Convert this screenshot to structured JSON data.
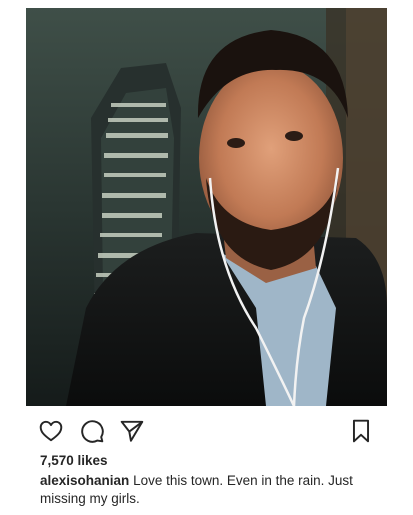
{
  "post": {
    "likes_text": "7,570 likes",
    "caption_username": "alexisohanian",
    "caption_text": "Love this town. Even in the rain. Just missing my girls."
  },
  "icons": {
    "like": "heart-icon",
    "comment": "comment-icon",
    "share": "send-icon",
    "save": "bookmark-icon"
  },
  "colors": {
    "text": "#262626",
    "icon_stroke": "#262626"
  }
}
